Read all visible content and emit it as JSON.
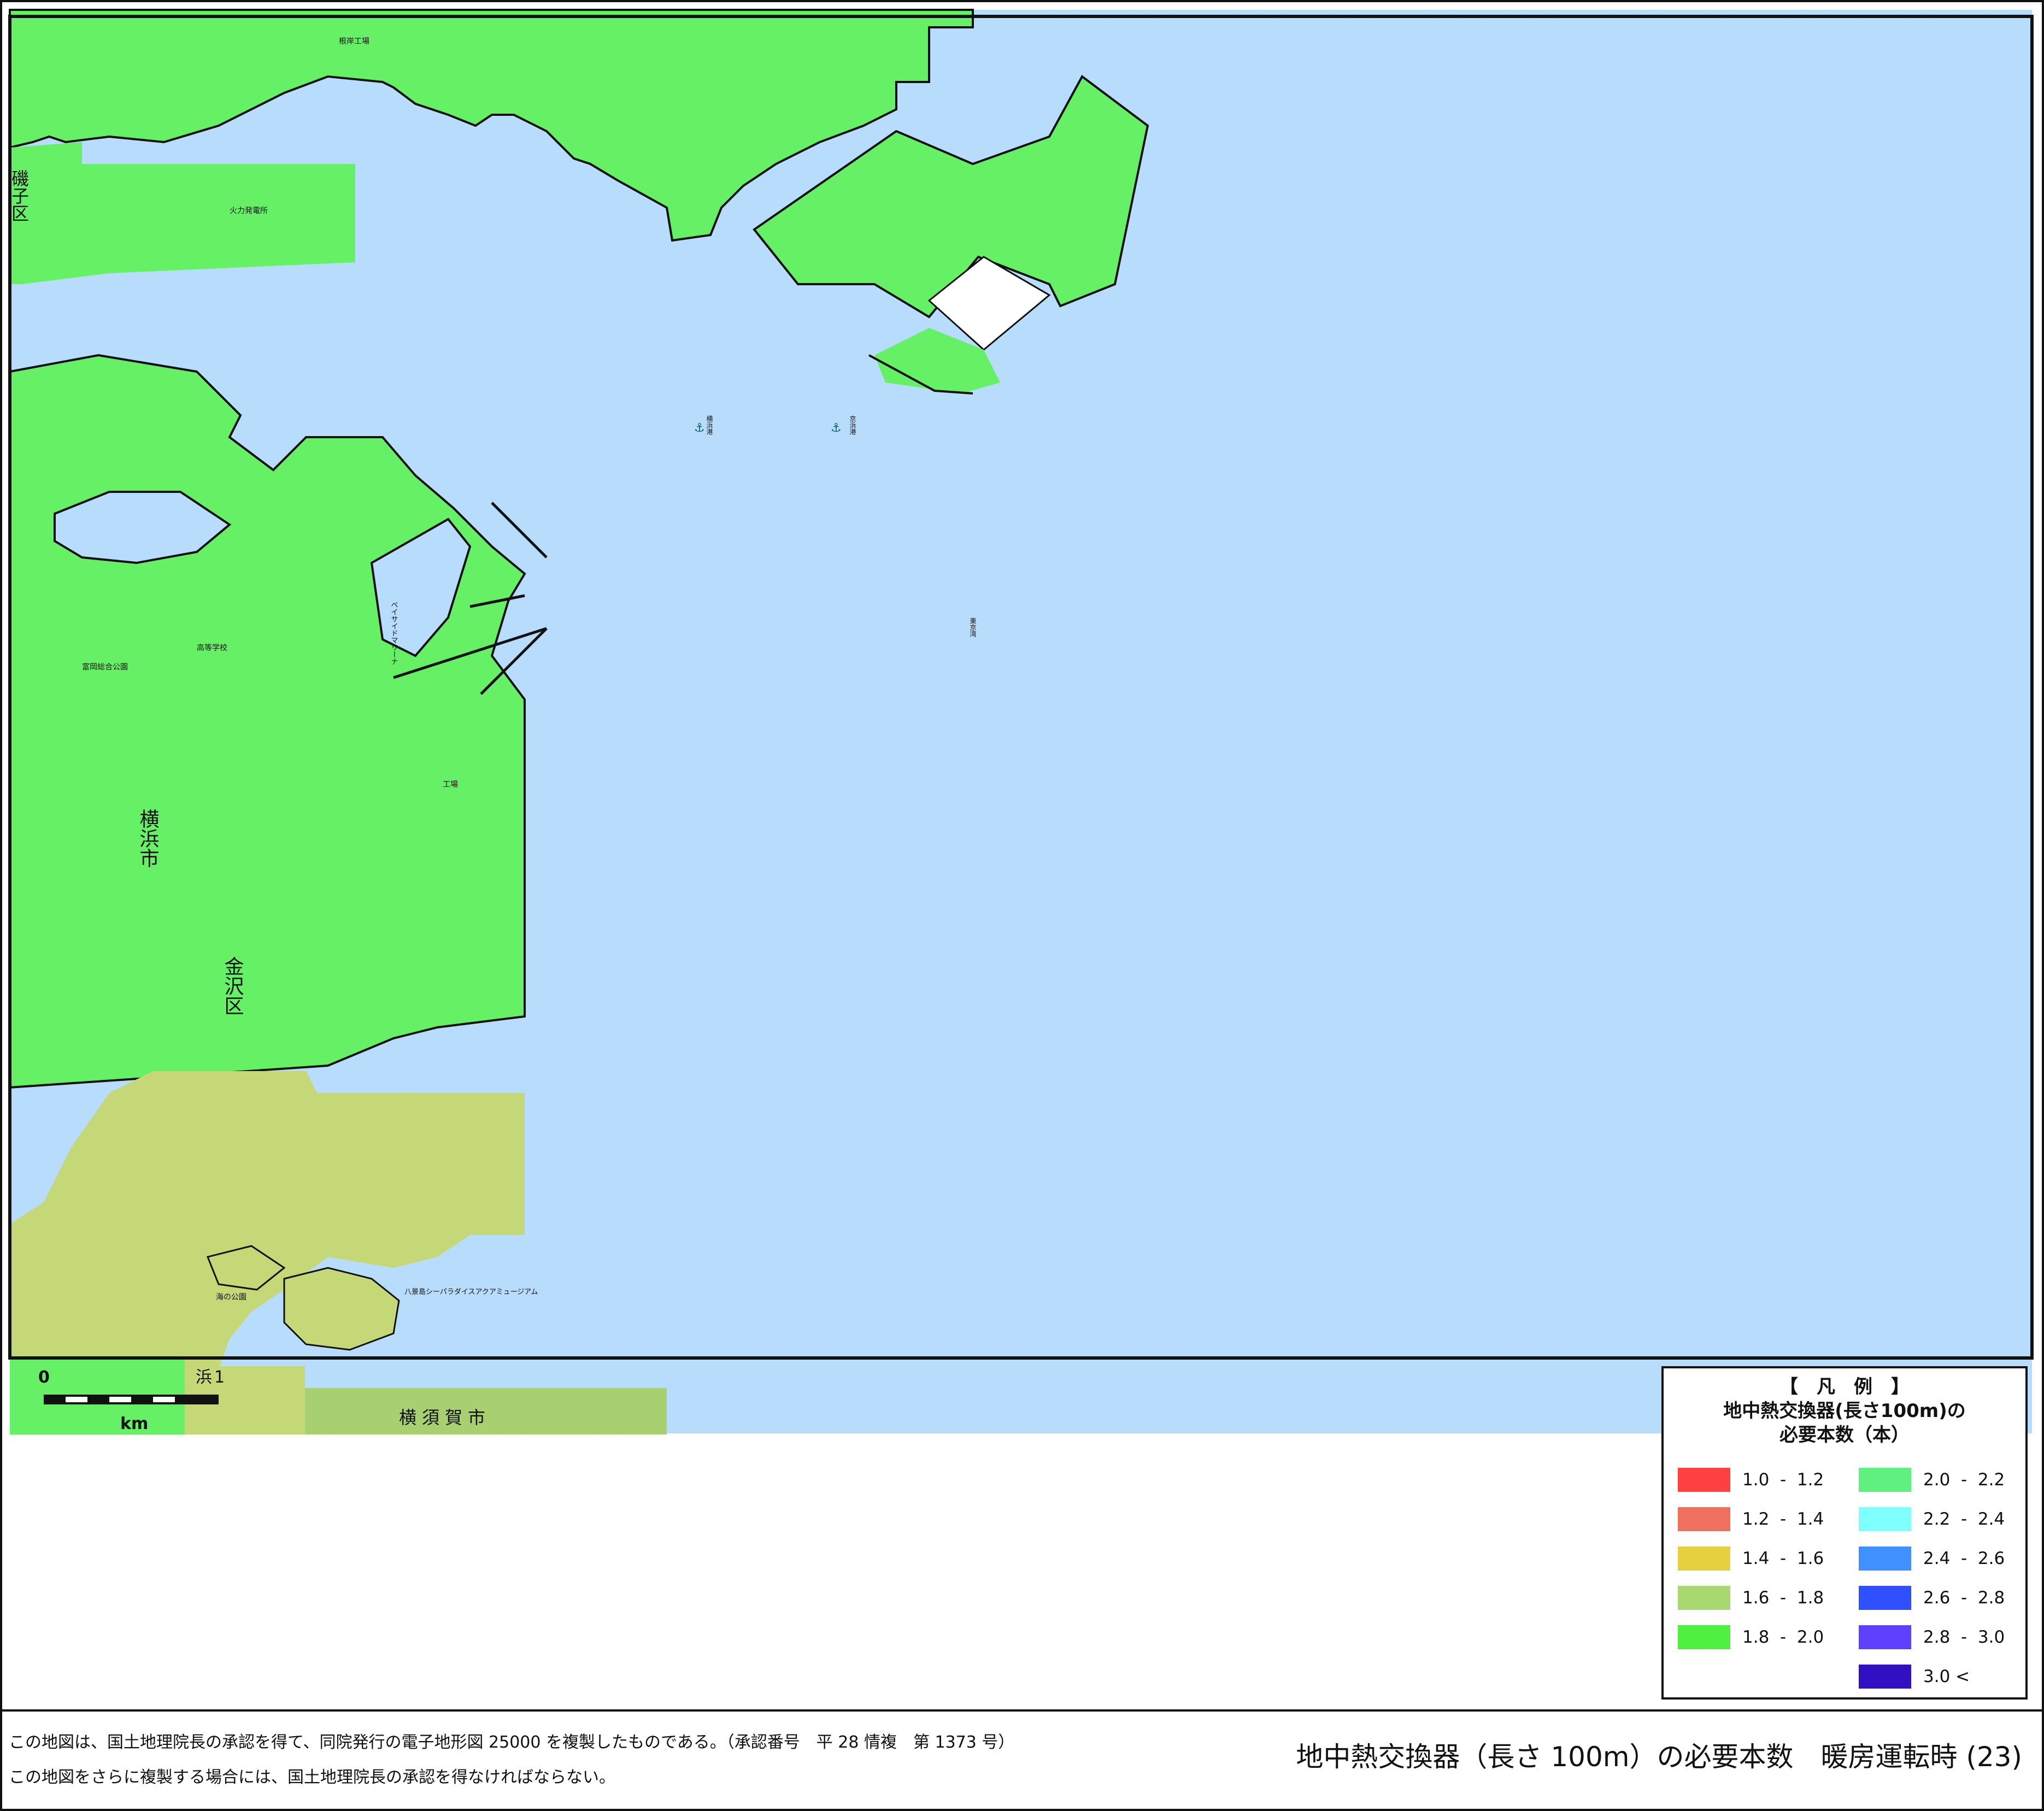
{
  "map": {
    "place_labels": {
      "yokohama_city": "横浜市",
      "kanazawa_ward": "金沢区",
      "isogo_ward": "磯子区",
      "yokosuka_city": "横須賀市",
      "yokohama_port": "横浜港",
      "hakkeijima": "八景島シーパラダイスアクアミュージアム",
      "umi_no_koen": "海の公園",
      "marina": "ベイサイドマリーナ",
      "tokyo_bay": "東京湾",
      "port_anchor": "京浜港",
      "coal_plant": "火力発電所",
      "plant_north": "根岸工場",
      "school": "高等学校",
      "park": "富岡総合公園",
      "factory_east": "工場",
      "small_label_1": "1",
      "small_label_2": "浜"
    },
    "scale_bar": {
      "zero": "0",
      "unit": "km"
    }
  },
  "legend": {
    "bracket_title": "【　凡　例　】",
    "title_line1": "地中熱交換器(長さ100m)の",
    "title_line2": "必要本数（本）",
    "items_left": [
      {
        "label": "1.0  -  1.2",
        "color": "#ff4040"
      },
      {
        "label": "1.2  -  1.4",
        "color": "#f07060"
      },
      {
        "label": "1.4  -  1.6",
        "color": "#e6d040"
      },
      {
        "label": "1.6  -  1.8",
        "color": "#a8d870"
      },
      {
        "label": "1.8  -  2.0",
        "color": "#50f040"
      }
    ],
    "items_right": [
      {
        "label": "2.0  -  2.2",
        "color": "#60f080"
      },
      {
        "label": "2.2  -  2.4",
        "color": "#80ffff"
      },
      {
        "label": "2.4  -  2.6",
        "color": "#4090ff"
      },
      {
        "label": "2.6  -  2.8",
        "color": "#3050ff"
      },
      {
        "label": "2.8  -  3.0",
        "color": "#6040ff"
      },
      {
        "label": "3.0 <",
        "color": "#3010c0"
      }
    ]
  },
  "footer": {
    "line1": "この地図は、国土地理院長の承認を得て、同院発行の電子地形図 25000 を複製したものである。（承認番号　平 28 情複　第 1373 号）",
    "line2": "この地図をさらに複製する場合には、国土地理院長の承認を得なければならない。",
    "title": "地中熱交換器（長さ 100m）の必要本数　暖房運転時 (23)"
  },
  "colors": {
    "sea": "#b8dcfc",
    "land_green": "#66f066",
    "land_yellow": "#c4d878",
    "land_olive": "#a8d070",
    "frame": "#111111"
  }
}
